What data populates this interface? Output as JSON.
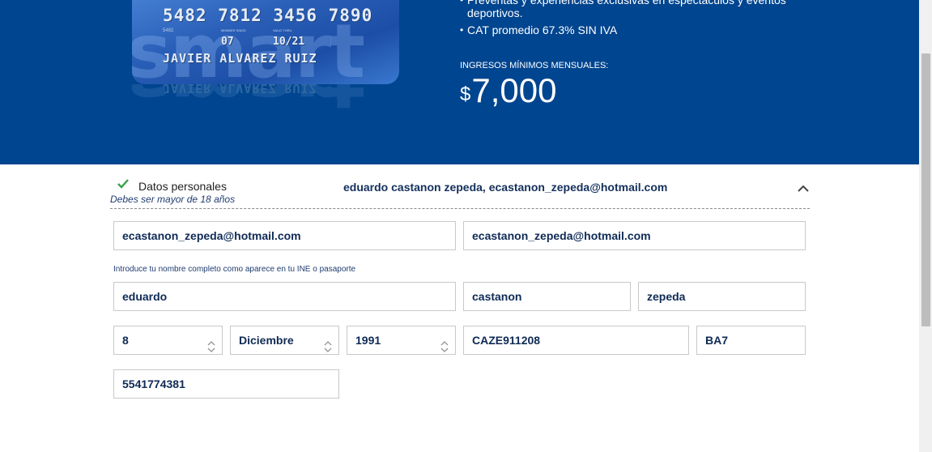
{
  "card": {
    "watermark": "smart",
    "number": "5482 7812 3456 7890",
    "small_code": "5482",
    "member_since_label": "MEMBER SINCE",
    "member_since": "07",
    "valid_thru_label": "VALID THRU",
    "valid_thru": "10/21",
    "holder_name": "JAVIER ALVAREZ RUIZ"
  },
  "benefits": [
    "Preventas y experiencias exclusivas en espectáculos y eventos deportivos.",
    "CAT promedio 67.3% SIN IVA"
  ],
  "income": {
    "label": "INGRESOS MÍNIMOS MENSUALES:",
    "currency": "$",
    "amount": "7,000"
  },
  "section": {
    "title": "Datos personales",
    "subtitle": "Debes ser mayor de 18 años",
    "summary": "eduardo castanon zepeda, ecastanon_zepeda@hotmail.com"
  },
  "form": {
    "email": "ecastanon_zepeda@hotmail.com",
    "email_confirm": "ecastanon_zepeda@hotmail.com",
    "name_hint": "Introduce tu nombre completo como aparece en tu INE o pasaporte",
    "first_name": "eduardo",
    "last_name_1": "castanon",
    "last_name_2": "zepeda",
    "birth_day": "8",
    "birth_month": "Diciembre",
    "birth_year": "1991",
    "rfc": "CAZE911208",
    "homoclave": "BA7",
    "phone": "5541774381"
  },
  "colors": {
    "hero_blue": "#00458f",
    "check_green": "#3aa14a",
    "text_navy": "#0f2a55"
  }
}
